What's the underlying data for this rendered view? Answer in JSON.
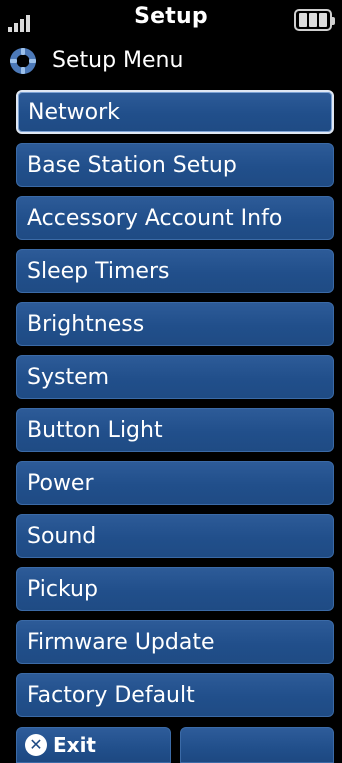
{
  "status_bar": {
    "title": "Setup",
    "signal_icon": "signal-icon",
    "battery_icon": "battery-icon"
  },
  "header": {
    "label": "Setup Menu",
    "icon": "gear-icon"
  },
  "menu": {
    "items": [
      {
        "label": "Network",
        "selected": true
      },
      {
        "label": "Base Station Setup"
      },
      {
        "label": "Accessory Account Info"
      },
      {
        "label": "Sleep Timers"
      },
      {
        "label": "Brightness"
      },
      {
        "label": "System"
      },
      {
        "label": "Button Light"
      },
      {
        "label": "Power"
      },
      {
        "label": "Sound"
      },
      {
        "label": "Pickup"
      },
      {
        "label": "Firmware Update"
      },
      {
        "label": "Factory Default"
      }
    ]
  },
  "softkeys": {
    "left_label": "Exit",
    "left_icon": "close-icon",
    "right_label": ""
  },
  "colors": {
    "accent": "#214f8b",
    "background": "#000000"
  }
}
